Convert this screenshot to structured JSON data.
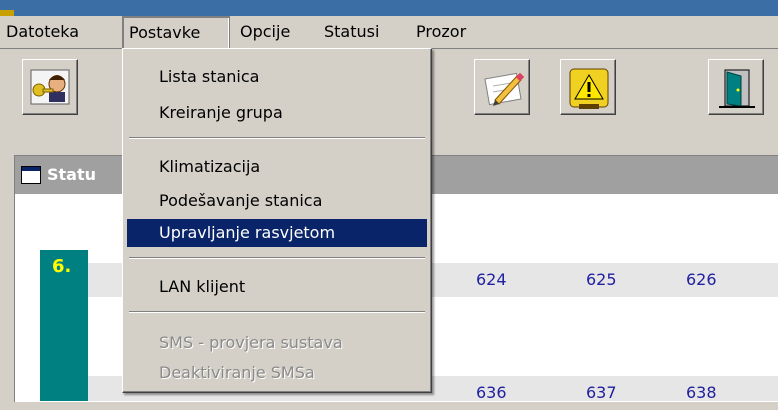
{
  "menubar": {
    "items": [
      {
        "label": "Datoteka"
      },
      {
        "label": "Postavke"
      },
      {
        "label": "Opcije"
      },
      {
        "label": "Statusi"
      },
      {
        "label": "Prozor"
      }
    ]
  },
  "dropdown": {
    "items": [
      {
        "label": "Lista stanica",
        "enabled": true
      },
      {
        "label": "Kreiranje grupa",
        "enabled": true
      },
      {
        "label": "Klimatizacija",
        "enabled": true
      },
      {
        "label": "Podešavanje stanica",
        "enabled": true
      },
      {
        "label": "Upravljanje rasvjetom",
        "enabled": true,
        "highlighted": true
      },
      {
        "label": "LAN klijent",
        "enabled": true
      },
      {
        "label": "SMS - provjera sustava",
        "enabled": false
      },
      {
        "label": "Deaktiviranje SMSa",
        "enabled": false
      }
    ]
  },
  "toolbar": {
    "buttons": [
      {
        "icon": "user-keys-icon"
      },
      {
        "icon": "pencil-edit-icon"
      },
      {
        "icon": "warning-icon"
      },
      {
        "icon": "exit-door-icon"
      }
    ]
  },
  "panel": {
    "title": "Statu"
  },
  "grid": {
    "rows": [
      {
        "label": "6.",
        "cells": [
          "624",
          "625",
          "626"
        ]
      },
      {
        "label": "",
        "cells": [
          "636",
          "637",
          "638"
        ]
      }
    ]
  },
  "colors": {
    "highlight": "#0a246a",
    "row_label_bg": "#008080",
    "row_label_text": "#ffff00",
    "cell_text": "#2020a0"
  }
}
